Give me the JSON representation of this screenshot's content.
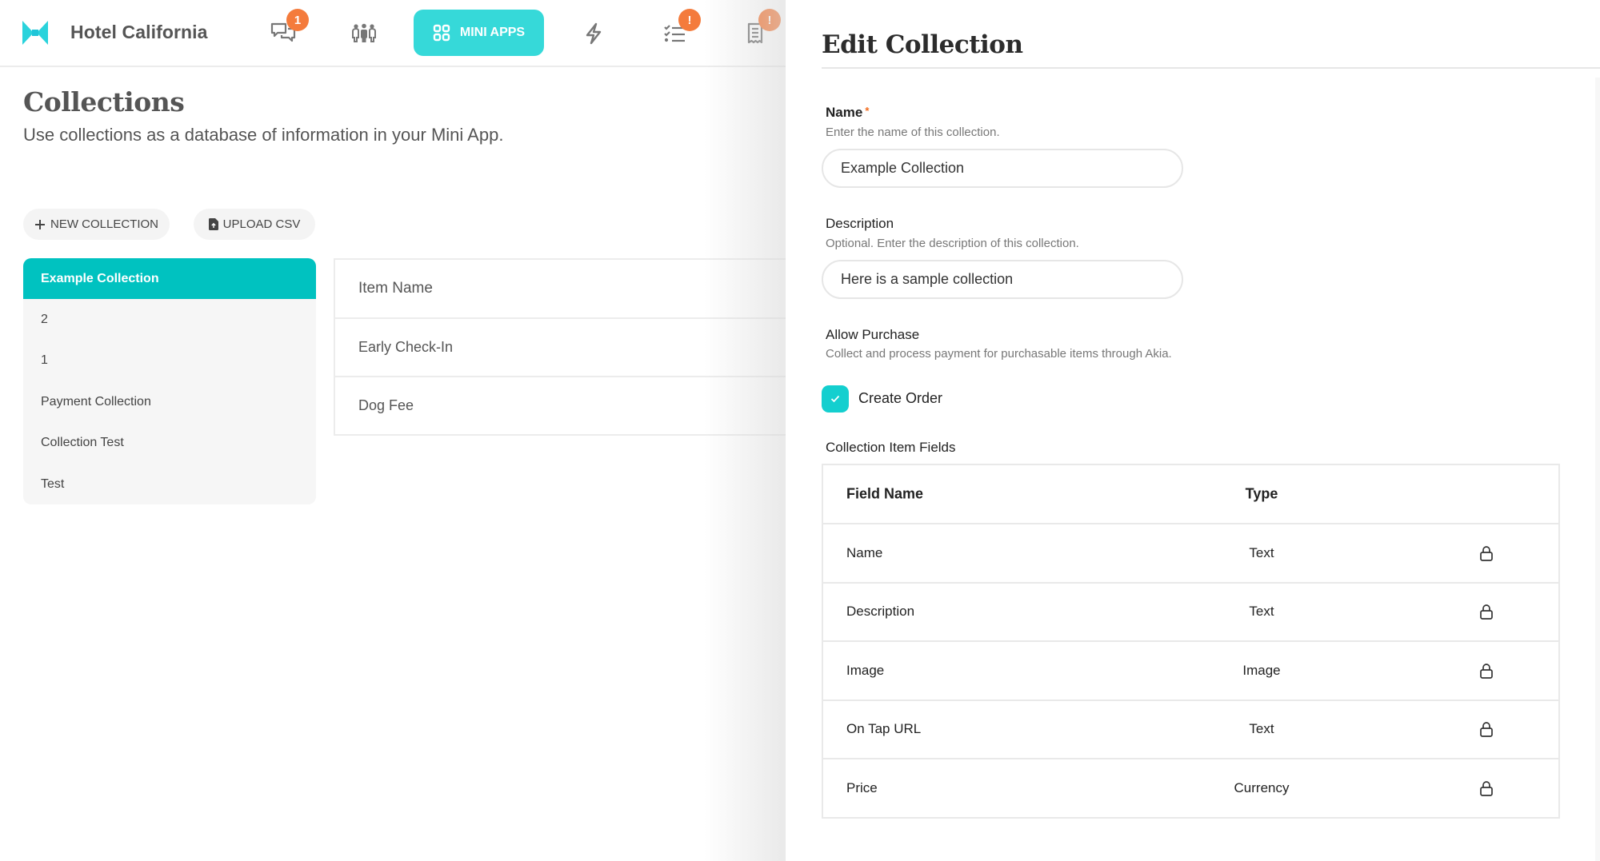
{
  "app": {
    "brand_name": "Hotel California",
    "logo_icon": "bowtie-logo-icon"
  },
  "nav": {
    "items": [
      {
        "id": "messages",
        "icon": "chat-bubbles-icon",
        "badge": "1"
      },
      {
        "id": "guests",
        "icon": "people-group-icon",
        "badge": null
      },
      {
        "id": "mini-apps",
        "icon": "grid-icon",
        "label": "MINI APPS",
        "active": true
      },
      {
        "id": "automations",
        "icon": "lightning-icon",
        "badge": null
      },
      {
        "id": "tasks",
        "icon": "checklist-icon",
        "badge": "!"
      },
      {
        "id": "orders",
        "icon": "receipt-icon",
        "badge": "!"
      }
    ]
  },
  "colors": {
    "accent": "#00c2c0",
    "nav_active": "#36d9d9",
    "badge": "#f47b3c",
    "required": "#f26b1d"
  },
  "collections_page": {
    "title": "Collections",
    "subtitle": "Use collections as a database of information in your Mini App.",
    "new_collection_label": "NEW COLLECTION",
    "upload_csv_label": "UPLOAD CSV",
    "collections": [
      {
        "name": "Example Collection",
        "active": true
      },
      {
        "name": "2"
      },
      {
        "name": "1"
      },
      {
        "name": "Payment Collection"
      },
      {
        "name": "Collection Test"
      },
      {
        "name": "Test"
      }
    ],
    "items_table": {
      "header": "Item Name",
      "rows": [
        "Early Check-In",
        "Dog Fee"
      ]
    }
  },
  "edit_panel": {
    "title": "Edit Collection",
    "name_field": {
      "label": "Name",
      "required_mark": "*",
      "help": "Enter the name of this collection.",
      "value": "Example Collection"
    },
    "description_field": {
      "label": "Description",
      "help": "Optional. Enter the description of this collection.",
      "value": "Here is a sample collection"
    },
    "allow_purchase": {
      "label": "Allow Purchase",
      "help": "Collect and process payment for purchasable items through Akia.",
      "checkbox_label": "Create Order",
      "checked": true
    },
    "fields_section_label": "Collection Item Fields",
    "fields_table": {
      "headers": {
        "name": "Field Name",
        "type": "Type"
      },
      "rows": [
        {
          "name": "Name",
          "type": "Text",
          "locked": true
        },
        {
          "name": "Description",
          "type": "Text",
          "locked": true
        },
        {
          "name": "Image",
          "type": "Image",
          "locked": true
        },
        {
          "name": "On Tap URL",
          "type": "Text",
          "locked": true
        },
        {
          "name": "Price",
          "type": "Currency",
          "locked": true
        }
      ]
    }
  }
}
